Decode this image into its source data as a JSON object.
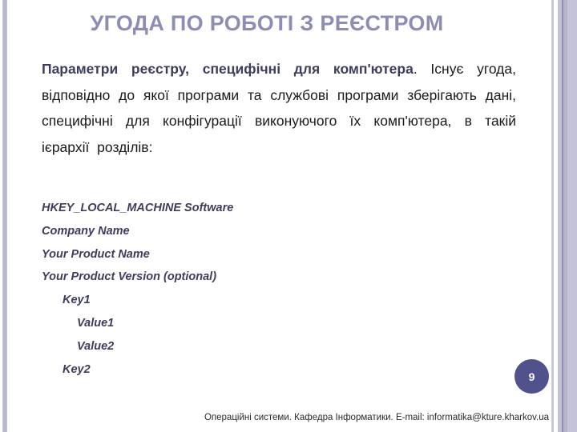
{
  "slide": {
    "title": "УГОДА ПО РОБОТІ З РЕЄСТРОМ",
    "body_lead": "Параметри реєстру, специфічні для комп'ютера",
    "body_rest": ". Існує угода, відповідно до якої програми та службові програми зберігають дані, специфічні для конфігурації виконуючого їх комп'ютера, в такій ієрархії розділів:",
    "tree": [
      {
        "level": 0,
        "text": "HKEY_LOCAL_MACHINE Software"
      },
      {
        "level": 0,
        "text": "Company Name"
      },
      {
        "level": 0,
        "text": "Your Product Name"
      },
      {
        "level": 0,
        "text": "Your Product Version (optional)"
      },
      {
        "level": 1,
        "text": "Key1"
      },
      {
        "level": 2,
        "text": "Value1"
      },
      {
        "level": 2,
        "text": "Value2"
      },
      {
        "level": 1,
        "text": "Key2"
      }
    ],
    "page_number": "9",
    "footer": "Операційні системи. Кафедра Інформатики. E-mail: informatika@kture.kharkov.ua"
  },
  "colors": {
    "title": "#8d8db3",
    "accent_text": "#3d3d5c",
    "badge": "#51518c"
  }
}
